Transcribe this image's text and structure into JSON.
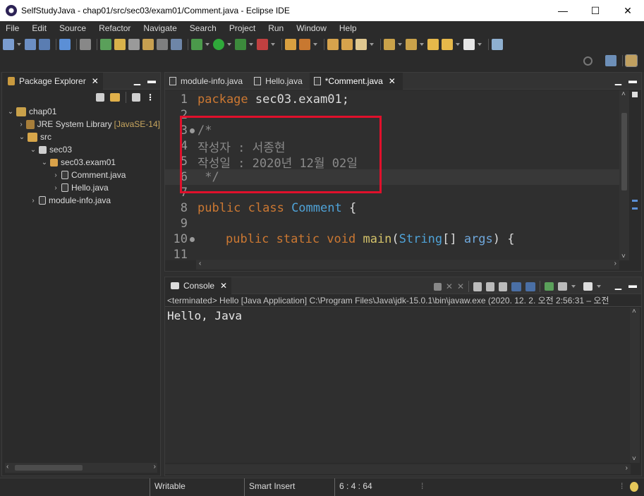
{
  "window": {
    "title": "SelfStudyJava - chap01/src/sec03/exam01/Comment.java - Eclipse IDE",
    "minimize": "—",
    "maximize": "☐",
    "close": "✕"
  },
  "menu": [
    "File",
    "Edit",
    "Source",
    "Refactor",
    "Navigate",
    "Search",
    "Project",
    "Run",
    "Window",
    "Help"
  ],
  "package_explorer": {
    "title": "Package Explorer",
    "tree": [
      {
        "label": "chap01",
        "decor": ""
      },
      {
        "label": "JRE System Library",
        "decor": "[JavaSE-14]"
      },
      {
        "label": "src",
        "decor": ""
      },
      {
        "label": "sec03",
        "decor": ""
      },
      {
        "label": "sec03.exam01",
        "decor": ""
      },
      {
        "label": "Comment.java",
        "decor": ""
      },
      {
        "label": "Hello.java",
        "decor": ""
      },
      {
        "label": "module-info.java",
        "decor": ""
      }
    ]
  },
  "editor": {
    "tabs": [
      {
        "label": "module-info.java"
      },
      {
        "label": "Hello.java"
      },
      {
        "label": "*Comment.java"
      }
    ],
    "lines": [
      {
        "num": "1",
        "text": [
          "package",
          " sec03.exam01;"
        ]
      },
      {
        "num": "2",
        "text": [
          ""
        ]
      },
      {
        "num": "3",
        "text": [
          "/*"
        ]
      },
      {
        "num": "4",
        "text": [
          "작성자 : 서종현"
        ]
      },
      {
        "num": "5",
        "text": [
          "작성일 : 2020년 12월 02일"
        ]
      },
      {
        "num": "6",
        "text": [
          " */"
        ]
      },
      {
        "num": "7",
        "text": [
          ""
        ]
      },
      {
        "num": "8",
        "text": [
          "public class",
          " Comment",
          " {"
        ]
      },
      {
        "num": "9",
        "text": [
          ""
        ]
      },
      {
        "num": "10",
        "text": [
          "public static void",
          " main",
          "(",
          "String",
          "[] ",
          "args",
          ") {"
        ]
      },
      {
        "num": "11",
        "text": [
          ""
        ]
      }
    ]
  },
  "console": {
    "title": "Console",
    "info": "<terminated> Hello [Java Application] C:\\Program Files\\Java\\jdk-15.0.1\\bin\\javaw.exe  (2020. 12. 2. 오전 2:56:31 – 오전",
    "output": "Hello, Java"
  },
  "status": {
    "writable": "Writable",
    "insert_mode": "Smart Insert",
    "position": "6 : 4 : 64"
  },
  "colors": {
    "annotation_box": "#e0102b",
    "keyword": "#cc7832",
    "comment": "#8a8a8a",
    "type": "#4fa3d8"
  }
}
